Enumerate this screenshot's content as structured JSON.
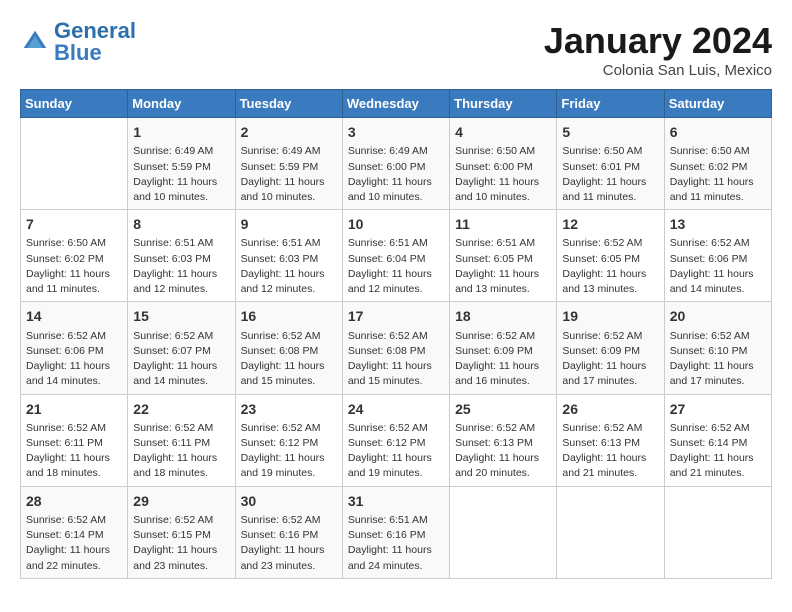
{
  "header": {
    "logo_general": "General",
    "logo_blue": "Blue",
    "title": "January 2024",
    "location": "Colonia San Luis, Mexico"
  },
  "days_of_week": [
    "Sunday",
    "Monday",
    "Tuesday",
    "Wednesday",
    "Thursday",
    "Friday",
    "Saturday"
  ],
  "weeks": [
    [
      {
        "day": "",
        "info": ""
      },
      {
        "day": "1",
        "info": "Sunrise: 6:49 AM\nSunset: 5:59 PM\nDaylight: 11 hours\nand 10 minutes."
      },
      {
        "day": "2",
        "info": "Sunrise: 6:49 AM\nSunset: 5:59 PM\nDaylight: 11 hours\nand 10 minutes."
      },
      {
        "day": "3",
        "info": "Sunrise: 6:49 AM\nSunset: 6:00 PM\nDaylight: 11 hours\nand 10 minutes."
      },
      {
        "day": "4",
        "info": "Sunrise: 6:50 AM\nSunset: 6:00 PM\nDaylight: 11 hours\nand 10 minutes."
      },
      {
        "day": "5",
        "info": "Sunrise: 6:50 AM\nSunset: 6:01 PM\nDaylight: 11 hours\nand 11 minutes."
      },
      {
        "day": "6",
        "info": "Sunrise: 6:50 AM\nSunset: 6:02 PM\nDaylight: 11 hours\nand 11 minutes."
      }
    ],
    [
      {
        "day": "7",
        "info": "Sunrise: 6:50 AM\nSunset: 6:02 PM\nDaylight: 11 hours\nand 11 minutes."
      },
      {
        "day": "8",
        "info": "Sunrise: 6:51 AM\nSunset: 6:03 PM\nDaylight: 11 hours\nand 12 minutes."
      },
      {
        "day": "9",
        "info": "Sunrise: 6:51 AM\nSunset: 6:03 PM\nDaylight: 11 hours\nand 12 minutes."
      },
      {
        "day": "10",
        "info": "Sunrise: 6:51 AM\nSunset: 6:04 PM\nDaylight: 11 hours\nand 12 minutes."
      },
      {
        "day": "11",
        "info": "Sunrise: 6:51 AM\nSunset: 6:05 PM\nDaylight: 11 hours\nand 13 minutes."
      },
      {
        "day": "12",
        "info": "Sunrise: 6:52 AM\nSunset: 6:05 PM\nDaylight: 11 hours\nand 13 minutes."
      },
      {
        "day": "13",
        "info": "Sunrise: 6:52 AM\nSunset: 6:06 PM\nDaylight: 11 hours\nand 14 minutes."
      }
    ],
    [
      {
        "day": "14",
        "info": "Sunrise: 6:52 AM\nSunset: 6:06 PM\nDaylight: 11 hours\nand 14 minutes."
      },
      {
        "day": "15",
        "info": "Sunrise: 6:52 AM\nSunset: 6:07 PM\nDaylight: 11 hours\nand 14 minutes."
      },
      {
        "day": "16",
        "info": "Sunrise: 6:52 AM\nSunset: 6:08 PM\nDaylight: 11 hours\nand 15 minutes."
      },
      {
        "day": "17",
        "info": "Sunrise: 6:52 AM\nSunset: 6:08 PM\nDaylight: 11 hours\nand 15 minutes."
      },
      {
        "day": "18",
        "info": "Sunrise: 6:52 AM\nSunset: 6:09 PM\nDaylight: 11 hours\nand 16 minutes."
      },
      {
        "day": "19",
        "info": "Sunrise: 6:52 AM\nSunset: 6:09 PM\nDaylight: 11 hours\nand 17 minutes."
      },
      {
        "day": "20",
        "info": "Sunrise: 6:52 AM\nSunset: 6:10 PM\nDaylight: 11 hours\nand 17 minutes."
      }
    ],
    [
      {
        "day": "21",
        "info": "Sunrise: 6:52 AM\nSunset: 6:11 PM\nDaylight: 11 hours\nand 18 minutes."
      },
      {
        "day": "22",
        "info": "Sunrise: 6:52 AM\nSunset: 6:11 PM\nDaylight: 11 hours\nand 18 minutes."
      },
      {
        "day": "23",
        "info": "Sunrise: 6:52 AM\nSunset: 6:12 PM\nDaylight: 11 hours\nand 19 minutes."
      },
      {
        "day": "24",
        "info": "Sunrise: 6:52 AM\nSunset: 6:12 PM\nDaylight: 11 hours\nand 19 minutes."
      },
      {
        "day": "25",
        "info": "Sunrise: 6:52 AM\nSunset: 6:13 PM\nDaylight: 11 hours\nand 20 minutes."
      },
      {
        "day": "26",
        "info": "Sunrise: 6:52 AM\nSunset: 6:13 PM\nDaylight: 11 hours\nand 21 minutes."
      },
      {
        "day": "27",
        "info": "Sunrise: 6:52 AM\nSunset: 6:14 PM\nDaylight: 11 hours\nand 21 minutes."
      }
    ],
    [
      {
        "day": "28",
        "info": "Sunrise: 6:52 AM\nSunset: 6:14 PM\nDaylight: 11 hours\nand 22 minutes."
      },
      {
        "day": "29",
        "info": "Sunrise: 6:52 AM\nSunset: 6:15 PM\nDaylight: 11 hours\nand 23 minutes."
      },
      {
        "day": "30",
        "info": "Sunrise: 6:52 AM\nSunset: 6:16 PM\nDaylight: 11 hours\nand 23 minutes."
      },
      {
        "day": "31",
        "info": "Sunrise: 6:51 AM\nSunset: 6:16 PM\nDaylight: 11 hours\nand 24 minutes."
      },
      {
        "day": "",
        "info": ""
      },
      {
        "day": "",
        "info": ""
      },
      {
        "day": "",
        "info": ""
      }
    ]
  ]
}
